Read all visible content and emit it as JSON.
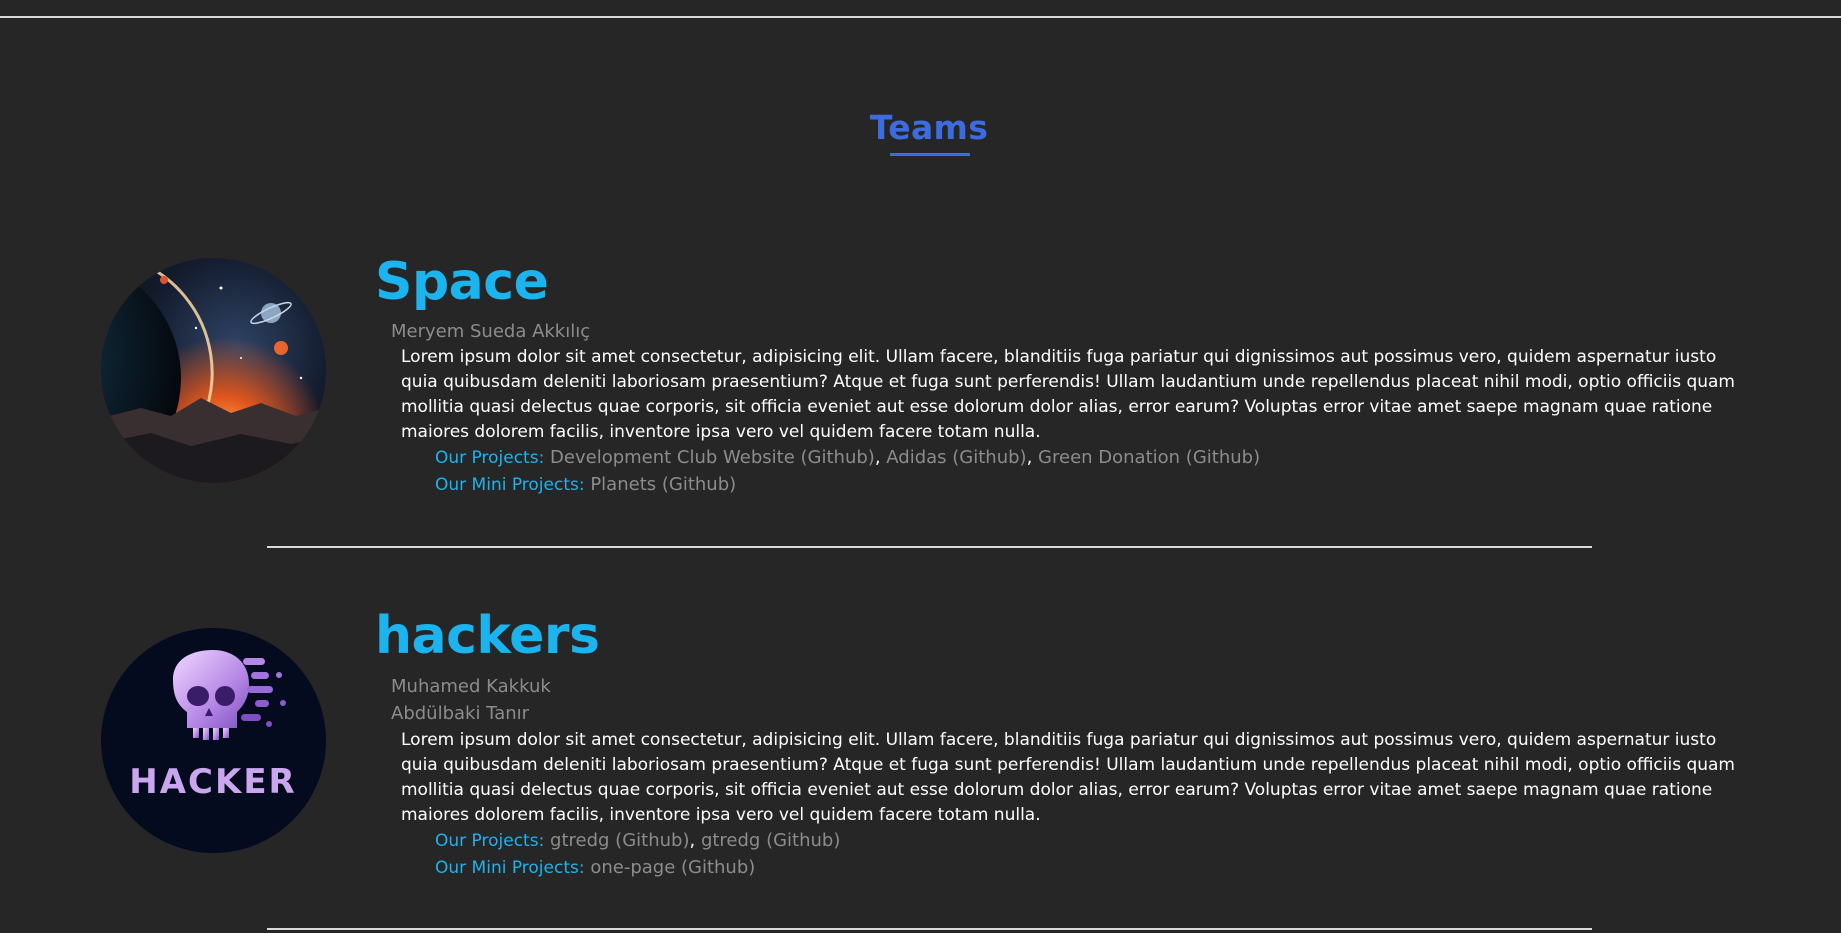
{
  "section": {
    "title": "Teams"
  },
  "teams": [
    {
      "name": "Space",
      "members": [
        "Meryem Sueda Akkılıç"
      ],
      "description": "Lorem ipsum dolor sit amet consectetur, adipisicing elit. Ullam facere, blanditiis fuga pariatur qui dignissimos aut possimus vero, quidem aspernatur iusto quia quibusdam deleniti laboriosam praesentium? Atque et fuga sunt perferendis! Ullam laudantium unde repellendus placeat nihil modi, optio officiis quam mollitia quasi delectus quae corporis, sit officia eveniet aut esse dolorum dolor alias, error earum? Voluptas error vitae amet saepe magnam quae ratione maiores dolorem facilis, inventore ipsa vero vel quidem facere totam nulla.",
      "projects_label": "Our Projects:",
      "projects": [
        "Development Club Website (Github)",
        "Adidas (Github)",
        "Green Donation (Github)"
      ],
      "mini_projects_label": "Our Mini Projects:",
      "mini_projects": [
        "Planets (Github)"
      ],
      "avatar_icon": "space-planet-image"
    },
    {
      "name": "hackers",
      "members": [
        "Muhamed Kakkuk",
        "Abdülbaki Tanır"
      ],
      "description": "Lorem ipsum dolor sit amet consectetur, adipisicing elit. Ullam facere, blanditiis fuga pariatur qui dignissimos aut possimus vero, quidem aspernatur iusto quia quibusdam deleniti laboriosam praesentium? Atque et fuga sunt perferendis! Ullam laudantium unde repellendus placeat nihil modi, optio officiis quam mollitia quasi delectus quae corporis, sit officia eveniet aut esse dolorum dolor alias, error earum? Voluptas error vitae amet saepe magnam quae ratione maiores dolorem facilis, inventore ipsa vero vel quidem facere totam nulla.",
      "projects_label": "Our Projects:",
      "projects": [
        "gtredg (Github)",
        "gtredg (Github)"
      ],
      "mini_projects_label": "Our Mini Projects:",
      "mini_projects": [
        "one-page (Github)"
      ],
      "avatar_icon": "hacker-skull-logo",
      "avatar_text": "HACKER"
    }
  ],
  "colors": {
    "background": "#262626",
    "title": "#3d6ce0",
    "accent": "#1cb4ee",
    "muted": "#8c8c8c",
    "text": "#ffffff"
  }
}
